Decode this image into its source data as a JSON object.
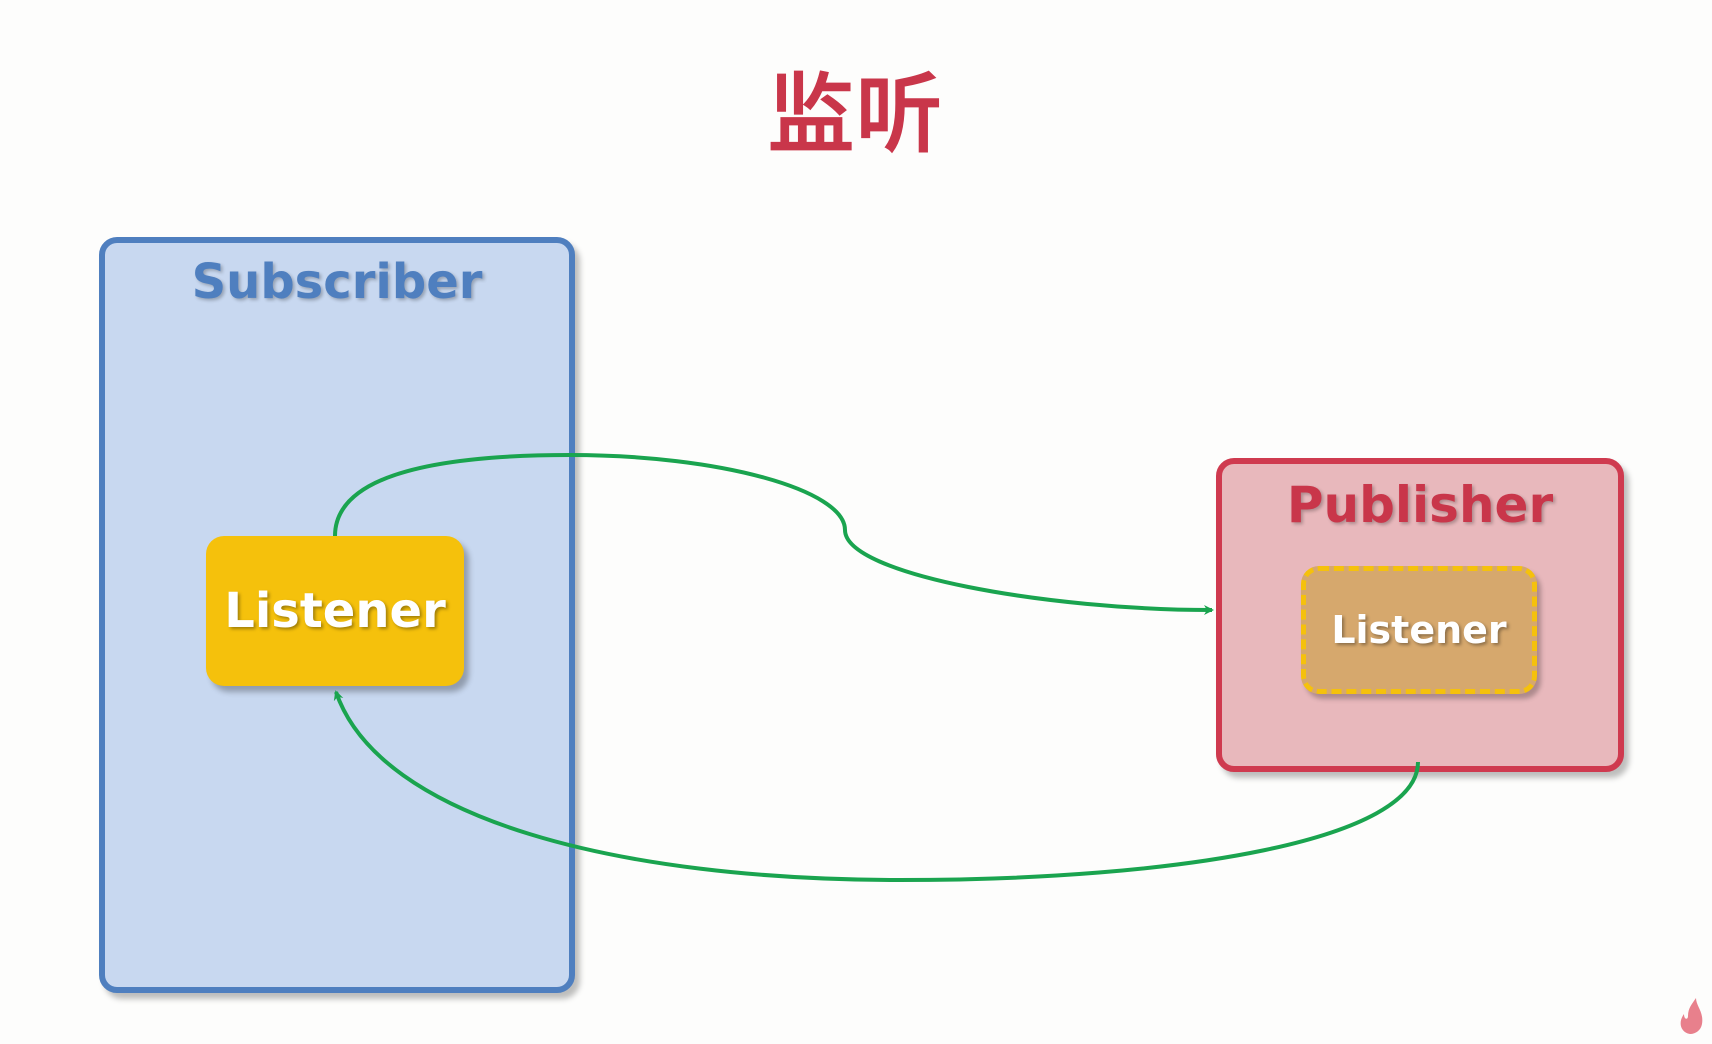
{
  "title": "监听",
  "subscriber": {
    "title": "Subscriber",
    "listener_label": "Listener",
    "colors": {
      "fill": "#c8d8f0",
      "border": "#4f7fbf",
      "listener": "#f5c10c"
    }
  },
  "publisher": {
    "title": "Publisher",
    "listener_label": "Listener",
    "colors": {
      "fill": "#e8b8bc",
      "border": "#cf3a4f",
      "listener": "#d6a86d"
    }
  },
  "arrows": [
    {
      "from": "subscriber.listener",
      "to": "publisher",
      "color": "#1aa44f"
    },
    {
      "from": "publisher",
      "to": "subscriber.listener",
      "color": "#1aa44f"
    }
  ],
  "logo_icon": "flame-icon"
}
